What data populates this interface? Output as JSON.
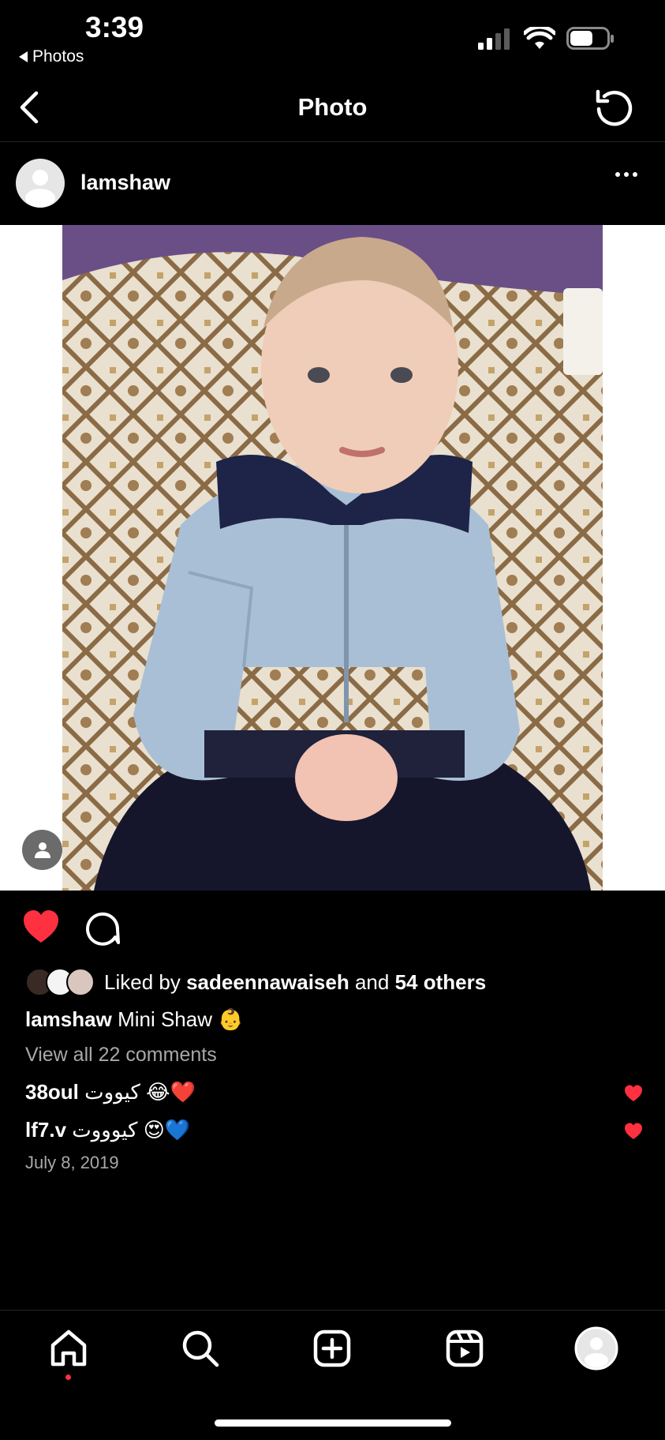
{
  "status_bar": {
    "time": "3:39",
    "back_app": "Photos",
    "battery_level": 0.62,
    "icons": [
      "signal-icon",
      "wifi-icon",
      "battery-icon"
    ]
  },
  "nav": {
    "title": "Photo",
    "back_icon": "chevron-left-icon",
    "refresh_icon": "refresh-icon"
  },
  "post": {
    "username": "lamshaw",
    "more_icon": "more-icon",
    "photo_description_icon": "user-tag-icon",
    "liked": true,
    "likes_prefix": "Liked by",
    "liked_by_user": "sadeennawaiseh",
    "likes_and": "and",
    "likes_others": "54 others",
    "caption_user": "lamshaw",
    "caption_text": "Mini Shaw 👶",
    "view_all_comments": "View all 22 comments",
    "comments": [
      {
        "user": "38oul",
        "text": "كيووت 😂❤️",
        "liked": true
      },
      {
        "user": "lf7.v",
        "text": "كيوووت 😍💙",
        "liked": true
      }
    ],
    "date": "July 8, 2019"
  },
  "tabbar": {
    "items": [
      "home-icon",
      "search-icon",
      "create-icon",
      "reels-icon",
      "profile-icon"
    ],
    "active": "home-icon"
  },
  "colors": {
    "background": "#000000",
    "like_red": "#ff3040",
    "muted_text": "#a8a8a8"
  }
}
